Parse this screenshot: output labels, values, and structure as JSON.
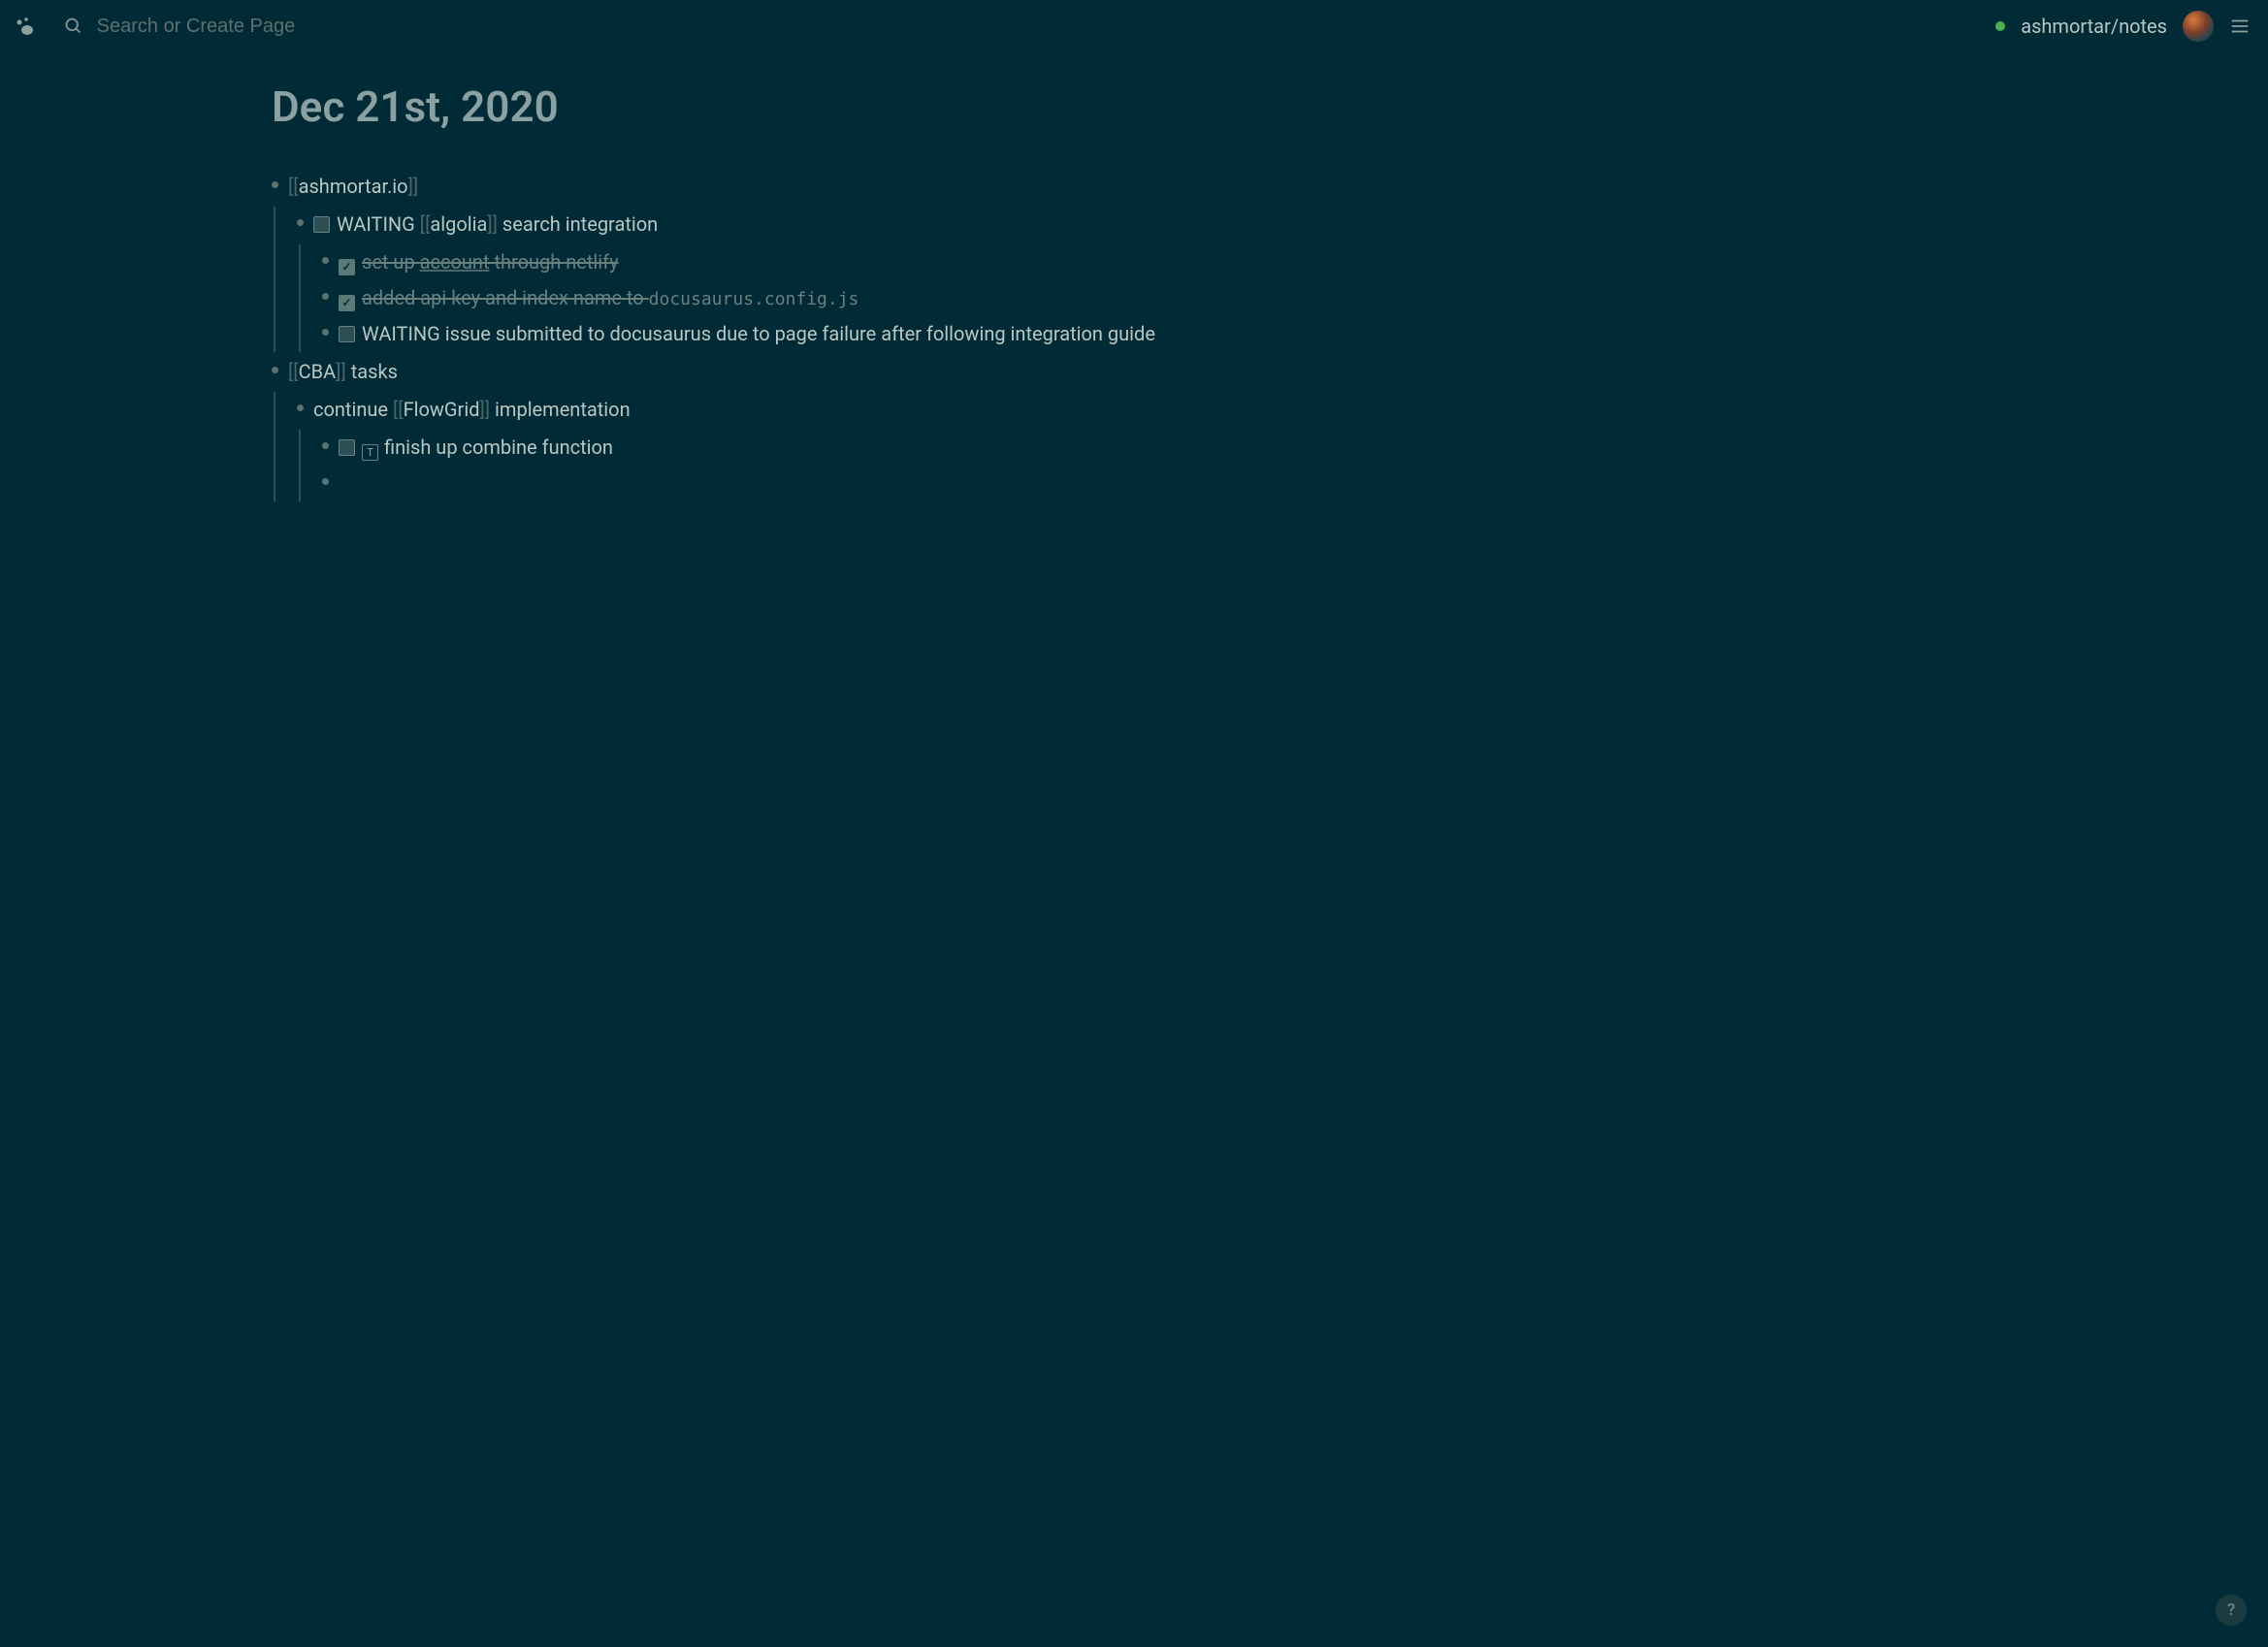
{
  "header": {
    "search_placeholder": "Search or Create Page",
    "repo": "ashmortar/notes",
    "status_color": "#4caf50"
  },
  "page": {
    "title": "Dec 21st, 2020"
  },
  "blocks": {
    "item1": {
      "link_text": "ashmortar.io",
      "child1": {
        "status": "WAITING",
        "link_text": "algolia",
        "suffix": " search integration",
        "sub1": {
          "checked": true,
          "text_pre": "set up ",
          "text_underline": "account",
          "text_post": " through netlify"
        },
        "sub2": {
          "checked": true,
          "text": "added api key and index name to ",
          "code": "docusaurus.config.js"
        },
        "sub3": {
          "status": "WAITING",
          "text": " issue submitted to docusaurus due to page failure after following integration guide"
        }
      }
    },
    "item2": {
      "link_text": "CBA",
      "suffix": " tasks",
      "child1": {
        "prefix": "continue ",
        "link_text": "FlowGrid",
        "suffix": " implementation",
        "sub1": {
          "badge": "T",
          "text": "finish up combine function"
        }
      }
    }
  },
  "help_label": "?"
}
